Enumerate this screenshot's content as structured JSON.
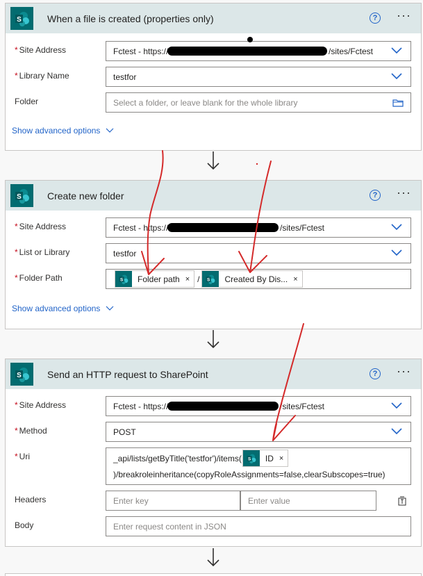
{
  "cards": [
    {
      "title": "When a file is created (properties only)",
      "fields": [
        {
          "label": "Site Address",
          "required": true,
          "value": "Fctest - https://",
          "value_suffix": "/sites/Fctest"
        },
        {
          "label": "Library Name",
          "required": true,
          "value": "testfor"
        },
        {
          "label": "Folder",
          "required": false,
          "placeholder": "Select a folder, or leave blank for the whole library"
        }
      ],
      "advanced": "Show advanced options"
    },
    {
      "title": "Create new folder",
      "fields": [
        {
          "label": "Site Address",
          "required": true,
          "value": "Fctest - https://",
          "value_suffix": "/sites/Fctest"
        },
        {
          "label": "List or Library",
          "required": true,
          "value": "testfor"
        },
        {
          "label": "Folder Path",
          "required": true,
          "tokens": [
            "Folder path",
            "Created By Dis..."
          ],
          "separator": "/"
        }
      ],
      "advanced": "Show advanced options"
    },
    {
      "title": "Send an HTTP request to SharePoint",
      "fields": [
        {
          "label": "Site Address",
          "required": true,
          "value": "Fctest - https://",
          "value_suffix": "/sites/Fctest"
        },
        {
          "label": "Method",
          "required": true,
          "value": "POST"
        },
        {
          "label": "Uri",
          "required": true,
          "line1": "_api/lists/getByTitle('testfor')/items(",
          "token": "ID",
          "line2": ")/breakroleinheritance(copyRoleAssignments=false,clearSubscopes=true)"
        },
        {
          "label": "Headers",
          "required": false,
          "key_placeholder": "Enter key",
          "value_placeholder": "Enter value"
        },
        {
          "label": "Body",
          "required": false,
          "placeholder": "Enter request content in JSON"
        }
      ]
    }
  ],
  "help_glyph": "?",
  "more_glyph": "···",
  "remove_glyph": "×",
  "colors": {
    "header_bg": "#dce7e8",
    "sp_tile": "#036c70",
    "link": "#2264c8",
    "required": "#c50f1f",
    "annotation": "#d42a2a"
  },
  "icons": [
    "sharepoint-icon",
    "help-icon",
    "more-options-icon",
    "chevron-down-icon",
    "folder-icon",
    "close-icon",
    "arrow-down-icon",
    "switch-to-text-icon"
  ]
}
